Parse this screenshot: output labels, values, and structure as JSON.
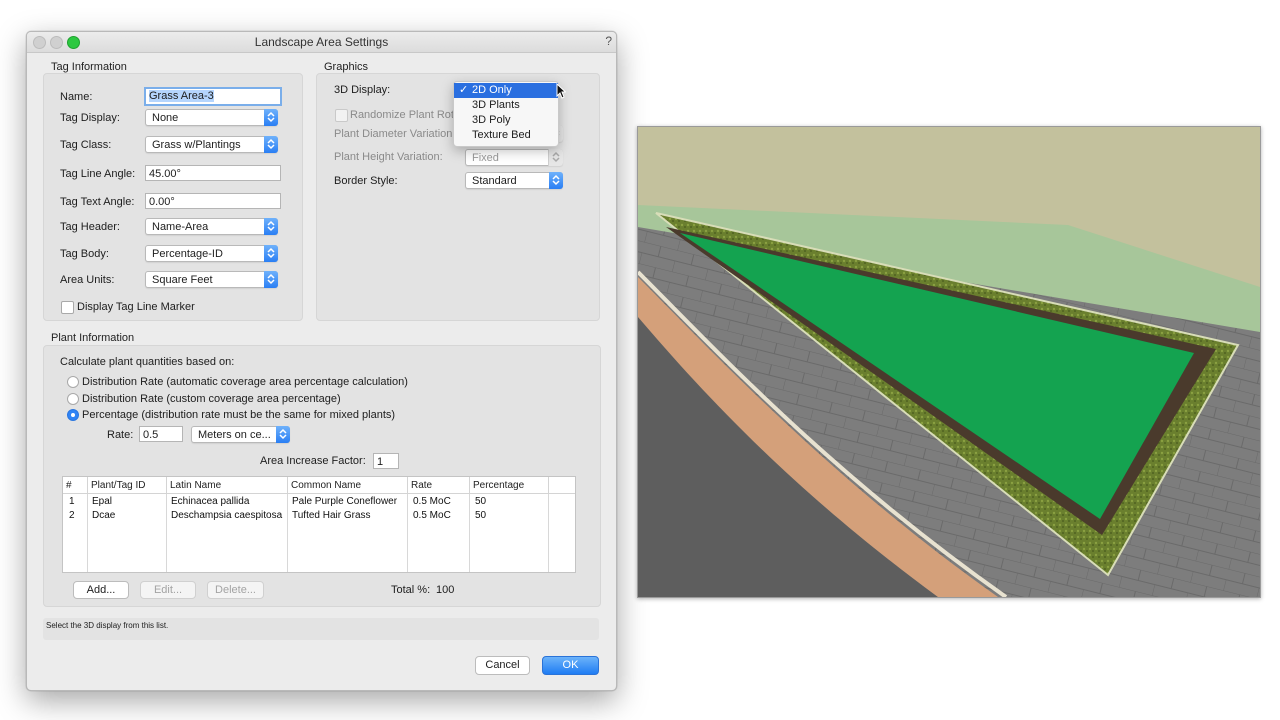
{
  "window": {
    "title": "Landscape Area Settings",
    "help": "?"
  },
  "tag_info": {
    "group_label": "Tag Information",
    "name_label": "Name:",
    "name_value": "Grass Area-3",
    "tag_display_label": "Tag Display:",
    "tag_display_value": "None",
    "tag_class_label": "Tag Class:",
    "tag_class_value": "Grass w/Plantings",
    "tag_line_angle_label": "Tag Line Angle:",
    "tag_line_angle_value": "45.00°",
    "tag_text_angle_label": "Tag Text Angle:",
    "tag_text_angle_value": "0.00°",
    "tag_header_label": "Tag Header:",
    "tag_header_value": "Name-Area",
    "tag_body_label": "Tag Body:",
    "tag_body_value": "Percentage-ID",
    "area_units_label": "Area Units:",
    "area_units_value": "Square Feet",
    "display_marker_label": "Display Tag Line Marker"
  },
  "graphics": {
    "group_label": "Graphics",
    "display_3d_label": "3D Display:",
    "randomize_label": "Randomize Plant Rot",
    "diameter_label": "Plant Diameter Variation",
    "height_label": "Plant Height Variation:",
    "height_value": "Fixed",
    "border_label": "Border Style:",
    "border_value": "Standard"
  },
  "menu": {
    "items": [
      {
        "label": "2D Only",
        "checked": "✓"
      },
      {
        "label": "3D Plants"
      },
      {
        "label": "3D Poly"
      },
      {
        "label": "Texture Bed"
      }
    ]
  },
  "plant_info": {
    "group_label": "Plant Information",
    "calc_label": "Calculate plant quantities based on:",
    "radio_1": "Distribution Rate (automatic coverage area percentage calculation)",
    "radio_2": "Distribution Rate (custom coverage area percentage)",
    "radio_3": "Percentage (distribution rate must be the same for mixed plants)",
    "rate_label": "Rate:",
    "rate_value": "0.5",
    "rate_unit": "Meters on ce...",
    "area_factor_label": "Area Increase Factor:",
    "area_factor_value": "1",
    "columns": [
      "#",
      "Plant/Tag ID",
      "Latin Name",
      "Common Name",
      "Rate",
      "Percentage"
    ],
    "rows": [
      {
        "num": "1",
        "id": "Epal",
        "latin": "Echinacea pallida",
        "common": "Pale Purple Coneflower",
        "rate": "0.5 MoC",
        "pct": "50"
      },
      {
        "num": "2",
        "id": "Dcae",
        "latin": "Deschampsia caespitosa",
        "common": "Tufted Hair Grass",
        "rate": "0.5 MoC",
        "pct": "50"
      }
    ],
    "add_label": "Add...",
    "edit_label": "Edit...",
    "delete_label": "Delete...",
    "total_label": "Total %:",
    "total_value": "100"
  },
  "status": "Select the 3D display from this list.",
  "buttons": {
    "cancel": "Cancel",
    "ok": "OK"
  },
  "colors": {
    "accent": "#2a6fe0",
    "lawn": "#14a350",
    "border_soil": "#4a3a2c",
    "walkway": "#d9a27a"
  }
}
